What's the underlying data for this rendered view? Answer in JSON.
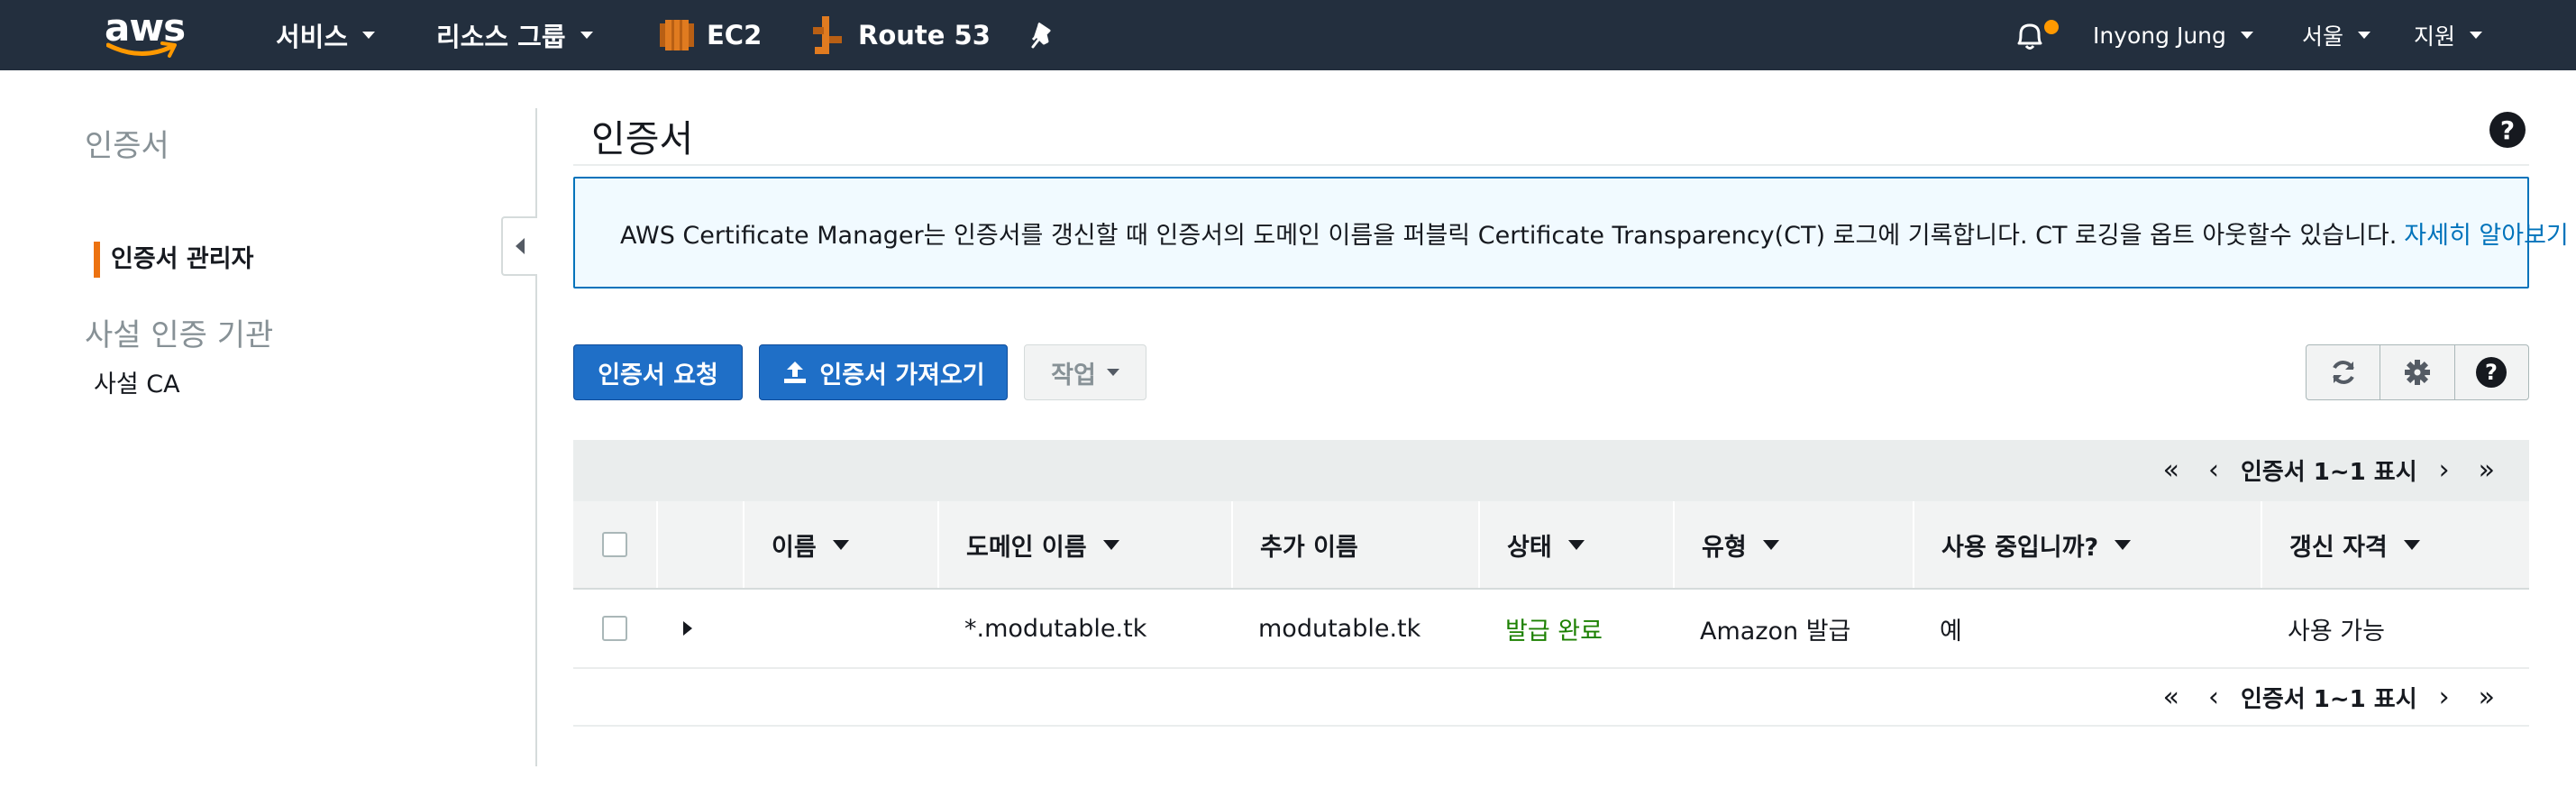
{
  "topnav": {
    "logo_text": "aws",
    "services": "서비스",
    "resource_groups": "리소스 그룹",
    "pinned": [
      "EC2",
      "Route 53"
    ],
    "user": "Inyong Jung",
    "region": "서울",
    "support": "지원",
    "icons": [
      "ec2-icon",
      "route53-icon",
      "pin-icon",
      "bell-icon"
    ],
    "accent_color": "#ff9900",
    "bg_color": "#232f3e"
  },
  "sidebar": {
    "section1": "인증서",
    "item1": "인증서 관리자",
    "section2": "사설 인증 기관",
    "item2": "사설 CA"
  },
  "main": {
    "title": "인증서",
    "info_text": "AWS Certificate Manager는 인증서를 갱신할 때 인증서의 도메인 이름을 퍼블릭 Certificate Transparency(CT) 로그에 기록합니다. CT 로깅을 옵트 아웃할수 있습니다.",
    "info_link": "자세히 알아보기",
    "buttons": {
      "request": "인증서 요청",
      "import": "인증서 가져오기",
      "actions": "작업"
    },
    "pager_text": "인증서 1~1 표시"
  },
  "table": {
    "columns": [
      "이름",
      "도메인 이름",
      "추가 이름",
      "상태",
      "유형",
      "사용 중입니까?",
      "갱신 자격"
    ],
    "rows": [
      {
        "name": "",
        "domain": "*.modutable.tk",
        "additional": "modutable.tk",
        "status": "발급 완료",
        "type": "Amazon 발급",
        "in_use": "예",
        "renewal": "사용 가능"
      }
    ]
  }
}
